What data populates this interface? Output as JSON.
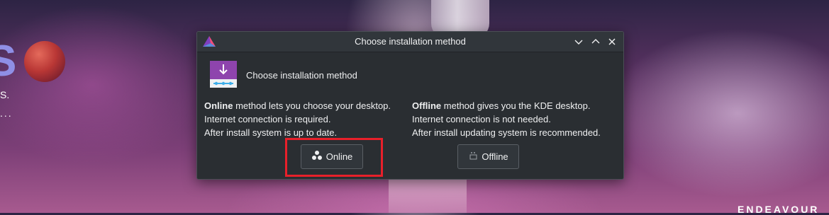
{
  "wallpaper": {
    "big_letter": "S",
    "line1": "S.",
    "line2": "...",
    "brand": "ENDEAVOUR"
  },
  "dialog": {
    "title": "Choose installation method",
    "header_text": "Choose installation method",
    "window_buttons": [
      "minimize",
      "maximize",
      "close"
    ],
    "online": {
      "bold": "Online",
      "line1_rest": " method lets you choose your desktop.",
      "line2": "Internet connection is required.",
      "line3": "After install system is up to date.",
      "button_label": "Online"
    },
    "offline": {
      "bold": "Offline",
      "line1_rest": " method gives you the KDE desktop.",
      "line2": "Internet connection is not needed.",
      "line3": "After install updating system is recommended.",
      "button_label": "Offline"
    }
  },
  "colors": {
    "dialog_bg": "#2a2e32",
    "titlebar_bg": "#31363b",
    "highlight": "#e8202a",
    "accent_purple": "#8e44ad"
  }
}
